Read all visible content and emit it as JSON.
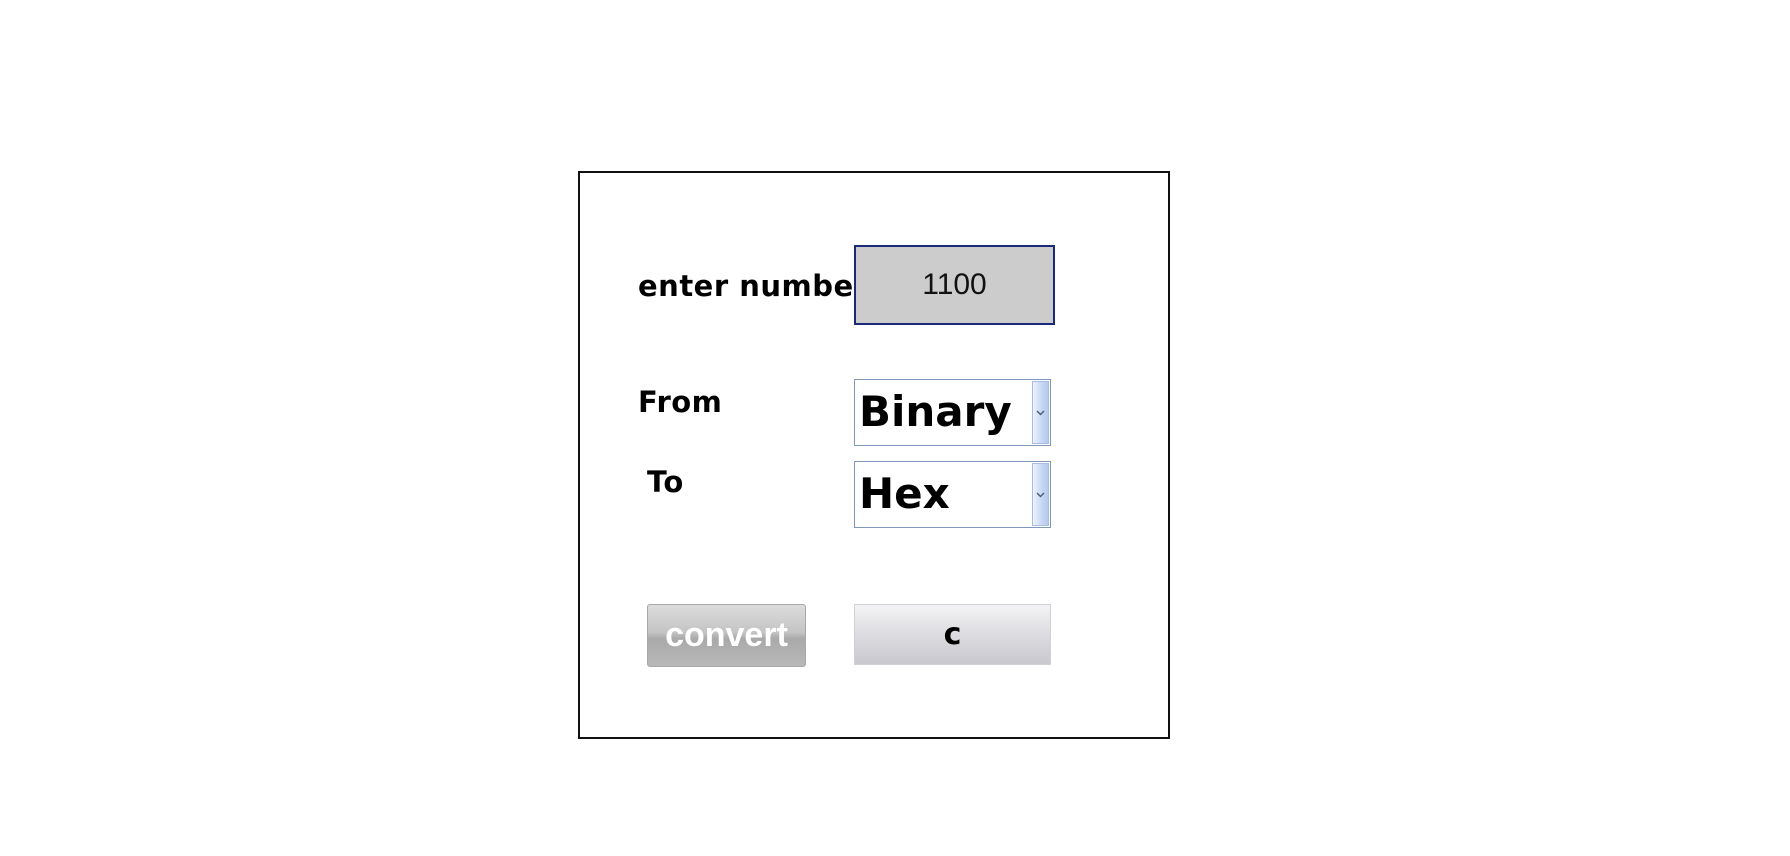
{
  "form": {
    "number_label": "enter number",
    "number_value": "1100",
    "from_label": "From",
    "from_value": "Binary",
    "to_label": "To",
    "to_value": "Hex",
    "convert_label": "convert",
    "clear_label": "c"
  },
  "icons": {
    "dropdown_arrow": "chevron-down-icon"
  },
  "colors": {
    "input_background": "#cccccc",
    "input_border": "#1a2a78",
    "select_border": "#7f97bf",
    "dropdown_button": "#c6d6f5",
    "convert_text": "#ffffff"
  }
}
